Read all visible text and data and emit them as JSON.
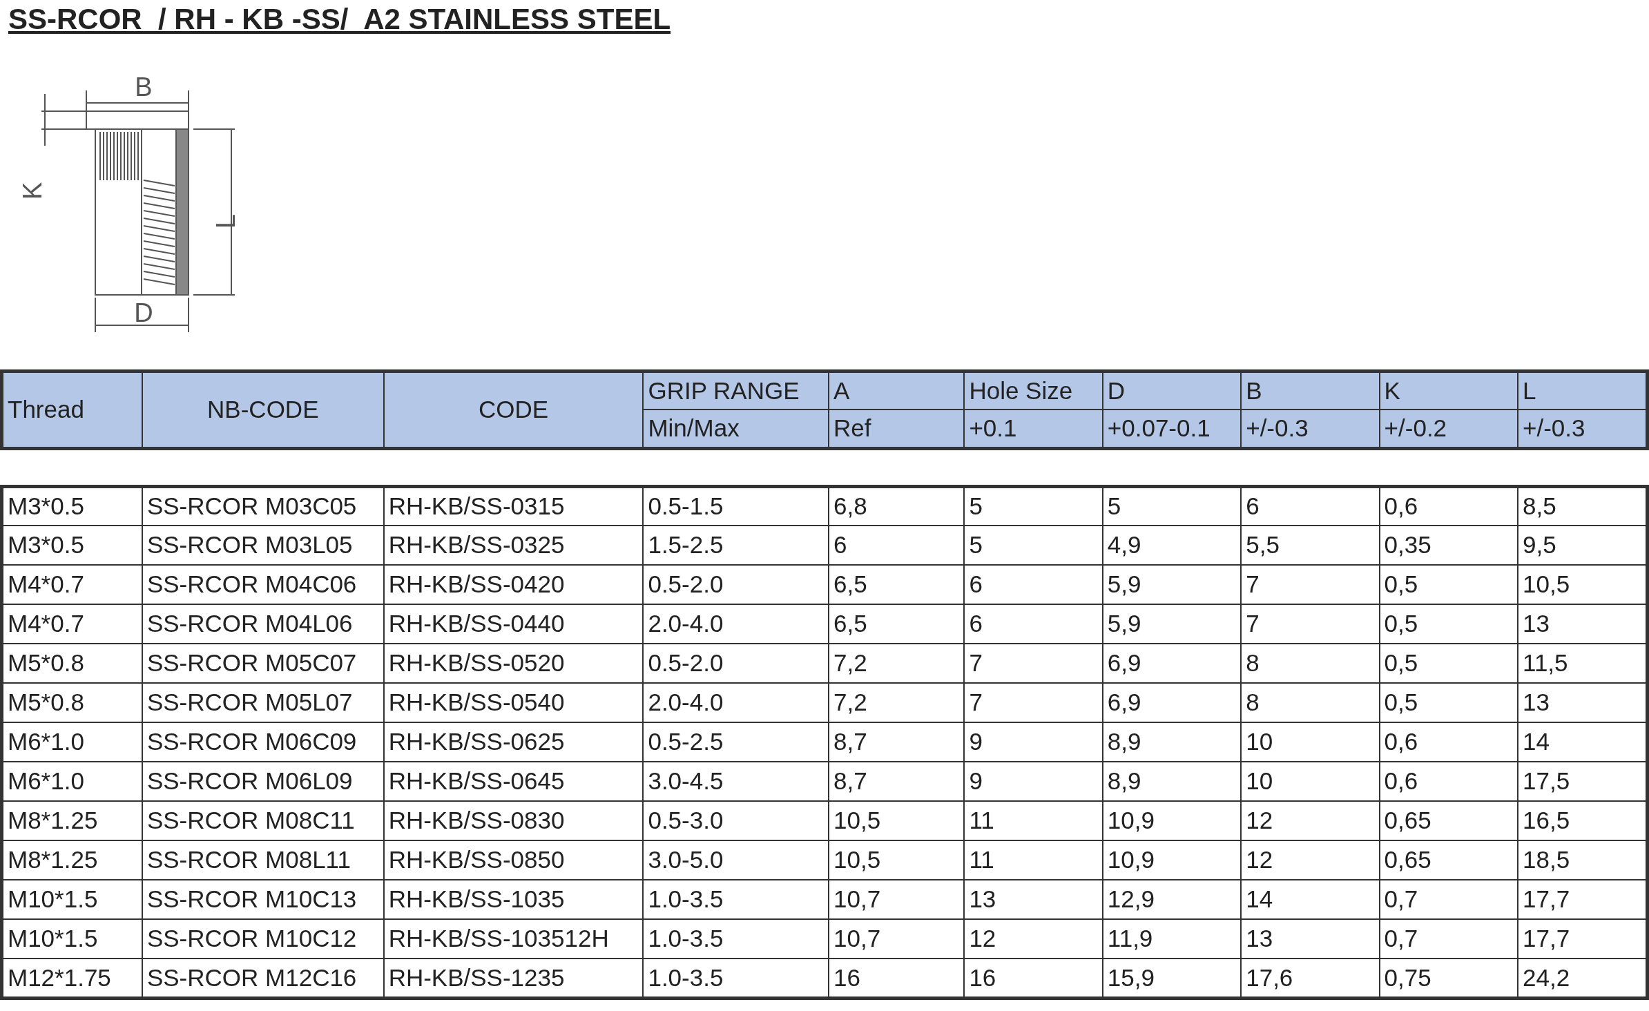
{
  "title": "SS-RCOR  / RH - KB -SS/  A2 STAINLESS STEEL",
  "drawing": {
    "labels": [
      "B",
      "K",
      "L",
      "D"
    ]
  },
  "table": {
    "columns": [
      {
        "top": "Thread"
      },
      {
        "top": "NB-CODE"
      },
      {
        "top": "CODE"
      },
      {
        "top": "GRIP RANGE",
        "bottom": "Min/Max"
      },
      {
        "top": "A",
        "bottom": "Ref"
      },
      {
        "top": "Hole Size",
        "bottom": "+0.1"
      },
      {
        "top": "D",
        "bottom": "+0.07-0.1"
      },
      {
        "top": "B",
        "bottom": "+/-0.3"
      },
      {
        "top": "K",
        "bottom": "+/-0.2"
      },
      {
        "top": "L",
        "bottom": "+/-0.3"
      }
    ],
    "rows": [
      [
        "M3*0.5",
        "SS-RCOR M03C05",
        "RH-KB/SS-0315",
        "0.5-1.5",
        "6,8",
        "5",
        "5",
        "6",
        "0,6",
        "8,5"
      ],
      [
        "M3*0.5",
        "SS-RCOR M03L05",
        "RH-KB/SS-0325",
        "1.5-2.5",
        "6",
        "5",
        "4,9",
        "5,5",
        "0,35",
        "9,5"
      ],
      [
        "M4*0.7",
        "SS-RCOR M04C06",
        "RH-KB/SS-0420",
        "0.5-2.0",
        "6,5",
        "6",
        "5,9",
        "7",
        "0,5",
        "10,5"
      ],
      [
        "M4*0.7",
        "SS-RCOR M04L06",
        "RH-KB/SS-0440",
        "2.0-4.0",
        "6,5",
        "6",
        "5,9",
        "7",
        "0,5",
        "13"
      ],
      [
        "M5*0.8",
        "SS-RCOR M05C07",
        "RH-KB/SS-0520",
        "0.5-2.0",
        "7,2",
        "7",
        "6,9",
        "8",
        "0,5",
        "11,5"
      ],
      [
        "M5*0.8",
        "SS-RCOR M05L07",
        "RH-KB/SS-0540",
        "2.0-4.0",
        "7,2",
        "7",
        "6,9",
        "8",
        "0,5",
        "13"
      ],
      [
        "M6*1.0",
        "SS-RCOR M06C09",
        "RH-KB/SS-0625",
        "0.5-2.5",
        "8,7",
        "9",
        "8,9",
        "10",
        "0,6",
        "14"
      ],
      [
        "M6*1.0",
        "SS-RCOR M06L09",
        "RH-KB/SS-0645",
        "3.0-4.5",
        "8,7",
        "9",
        "8,9",
        "10",
        "0,6",
        "17,5"
      ],
      [
        "M8*1.25",
        "SS-RCOR M08C11",
        "RH-KB/SS-0830",
        "0.5-3.0",
        "10,5",
        "11",
        "10,9",
        "12",
        "0,65",
        "16,5"
      ],
      [
        "M8*1.25",
        "SS-RCOR M08L11",
        "RH-KB/SS-0850",
        "3.0-5.0",
        "10,5",
        "11",
        "10,9",
        "12",
        "0,65",
        "18,5"
      ],
      [
        "M10*1.5",
        "SS-RCOR M10C13",
        "RH-KB/SS-1035",
        "1.0-3.5",
        "10,7",
        "13",
        "12,9",
        "14",
        "0,7",
        "17,7"
      ],
      [
        "M10*1.5",
        "SS-RCOR M10C12",
        "RH-KB/SS-103512H",
        "1.0-3.5",
        "10,7",
        "12",
        "11,9",
        "13",
        "0,7",
        "17,7"
      ],
      [
        "M12*1.75",
        "SS-RCOR M12C16",
        "RH-KB/SS-1235",
        "1.0-3.5",
        "16",
        "16",
        "15,9",
        "17,6",
        "0,75",
        "24,2"
      ]
    ]
  }
}
